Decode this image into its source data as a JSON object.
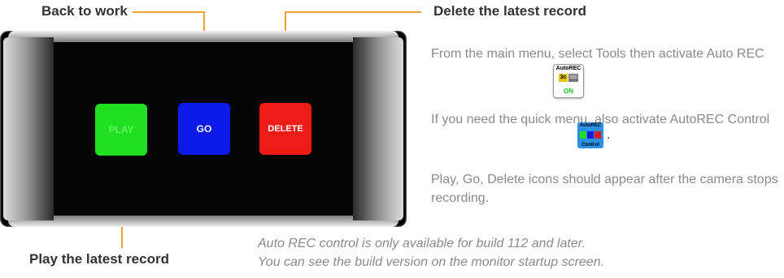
{
  "callouts": {
    "back": "Back to work",
    "delete": "Delete the latest record",
    "play": "Play the latest record"
  },
  "buttons": {
    "play": "PLAY",
    "go": "GO",
    "delete": "DELETE"
  },
  "instructions": {
    "p1": "From the main menu, select Tools then activate Auto REC",
    "p2": "If you need the quick menu, also activate AutoREC Control",
    "p3": "Play, Go, Delete icons should appear after the camera stops recording."
  },
  "icons": {
    "autorec": {
      "title": "AutoREC",
      "badge": "3c",
      "sd": "SDI",
      "state": "ON"
    },
    "autorec_control": {
      "title": "AutoREC",
      "subtitle": "Control"
    }
  },
  "note": {
    "line1": "Auto REC control is only available for build 112 and later.",
    "line2": "You can see the build version on the monitor startup screen."
  },
  "colors": {
    "accent": "#f0a030",
    "play": "#21e021",
    "go": "#0a1ae8",
    "delete": "#ee1c16"
  }
}
